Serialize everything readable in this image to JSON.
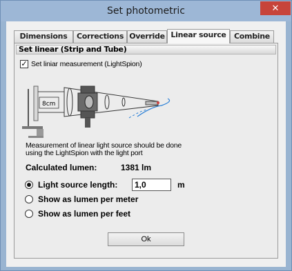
{
  "window": {
    "title": "Set photometric",
    "close_icon": "close-icon"
  },
  "tabs": [
    {
      "label": "Dimensions",
      "active": false
    },
    {
      "label": "Corrections",
      "active": false
    },
    {
      "label": "Override",
      "active": false
    },
    {
      "label": "Linear source",
      "active": true
    },
    {
      "label": "Combine",
      "active": false
    }
  ],
  "group": {
    "title": "Set linear (Strip and Tube)"
  },
  "checkbox": {
    "label": "Set liniar measurement (LightSpion)",
    "checked": true
  },
  "diagram": {
    "distance_label": "8cm"
  },
  "description": "Measurement of linear light source should be done using the LightSpion with the light port",
  "calculated": {
    "label": "Calculated lumen:",
    "value": "1381 lm"
  },
  "options": [
    {
      "label": "Light source length:",
      "checked": true,
      "input_value": "1,0",
      "unit": "m"
    },
    {
      "label": "Show as lumen per meter",
      "checked": false
    },
    {
      "label": "Show as lumen per feet",
      "checked": false
    }
  ],
  "ok_button": "Ok",
  "colors": {
    "titlebar": "#9db7d6",
    "close": "#c7443a",
    "frame": "#99b4d1",
    "dialog_bg": "#f0f0f0"
  }
}
